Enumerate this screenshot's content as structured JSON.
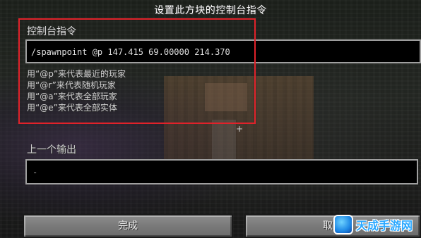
{
  "dialog": {
    "title": "设置此方块的控制台指令"
  },
  "command": {
    "label": "控制台指令",
    "value": "/spawnpoint @p 147.415 69.00000 214.370",
    "hints": [
      "用“@p”来代表最近的玩家",
      "用“@r”来代表随机玩家",
      "用“@a”来代表全部玩家",
      "用“@e”来代表全部实体"
    ]
  },
  "output": {
    "label": "上一个输出",
    "value": "-"
  },
  "buttons": {
    "done": "完成",
    "cancel": "取消"
  },
  "crosshair": "+",
  "watermark": {
    "text": "天成手游网",
    "icon": "game-badge-icon"
  },
  "colors": {
    "highlight": "#e0222a",
    "field_background": "#000000",
    "field_border": "#a0a0a0",
    "button": "#7a7a7a",
    "watermark": "#2aa8ff"
  }
}
